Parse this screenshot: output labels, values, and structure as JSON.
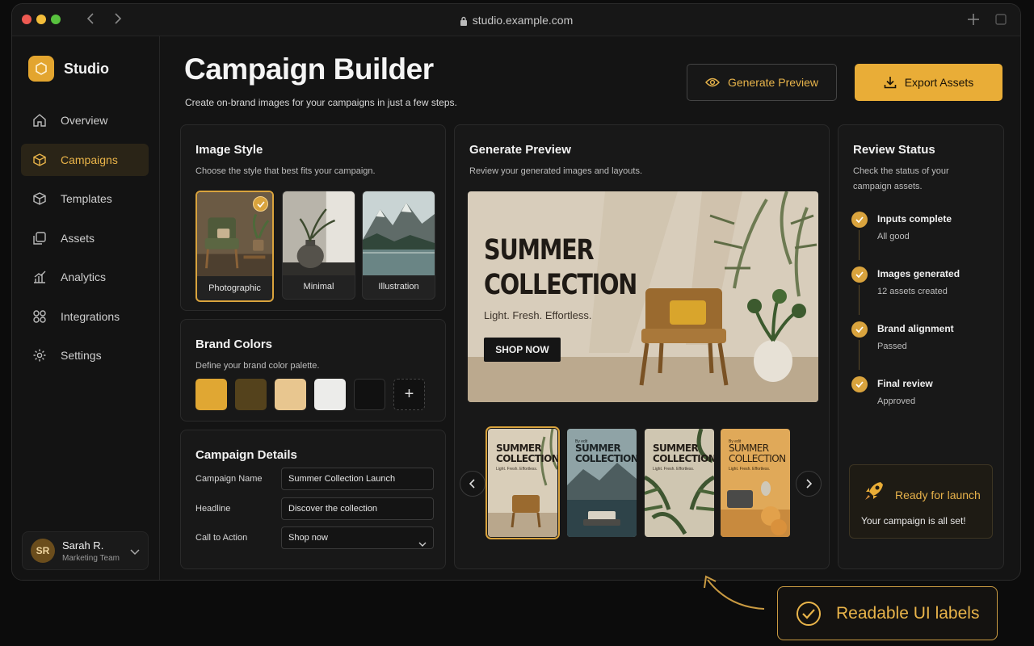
{
  "browser": {
    "url": "studio.example.com"
  },
  "brand": {
    "name": "Studio"
  },
  "nav": {
    "items": [
      {
        "label": "Overview",
        "icon": "home-icon"
      },
      {
        "label": "Campaigns",
        "icon": "box-icon",
        "active": true
      },
      {
        "label": "Templates",
        "icon": "cube-icon"
      },
      {
        "label": "Assets",
        "icon": "layers-icon"
      },
      {
        "label": "Analytics",
        "icon": "chart-icon"
      },
      {
        "label": "Integrations",
        "icon": "integrations-icon"
      },
      {
        "label": "Settings",
        "icon": "gear-icon"
      }
    ]
  },
  "user": {
    "initials": "SR",
    "name": "Sarah R.",
    "role": "Marketing Team"
  },
  "header": {
    "title": "Campaign Builder",
    "subtitle": "Create on-brand images for your campaigns in just a few steps.",
    "generate_label": "Generate Preview",
    "export_label": "Export Assets"
  },
  "image_style": {
    "title": "Image Style",
    "subtitle": "Choose the style that best fits your campaign.",
    "options": [
      {
        "label": "Photographic",
        "selected": true
      },
      {
        "label": "Minimal",
        "selected": false
      },
      {
        "label": "Illustration",
        "selected": false
      }
    ]
  },
  "brand_colors": {
    "title": "Brand Colors",
    "subtitle": "Define your brand color palette.",
    "colors": [
      "#e0a733",
      "#54421c",
      "#e8c68f",
      "#ececea",
      "#111111"
    ],
    "add_label": "+"
  },
  "details": {
    "title": "Campaign Details",
    "fields": [
      {
        "label": "Campaign Name",
        "value": "Summer Collection Launch"
      },
      {
        "label": "Headline",
        "value": "Discover the collection"
      },
      {
        "label": "Call to Action",
        "value": "Shop now"
      }
    ]
  },
  "preview": {
    "title": "Generate Preview",
    "subtitle": "Review your generated images and layouts.",
    "hero_title": "SUMMER\nCOLLECTION",
    "hero_tagline": "Light. Fresh. Effortless.",
    "hero_cta": "SHOP NOW",
    "thumbnails": [
      {
        "kicker": "",
        "title": "SUMMER\nCOLLECTION",
        "sub": "Light. Fresh. Effortless."
      },
      {
        "kicker": "By edit",
        "title": "SUMMER\nCOLLECTION",
        "sub": ""
      },
      {
        "kicker": "",
        "title": "SUMMER\nCOLLECTION",
        "sub": "Light. Fresh. Effortless."
      },
      {
        "kicker": "By edit",
        "title": "SUMMER\nCOLLECTION",
        "sub": "Light. Fresh. Effortless."
      }
    ]
  },
  "review": {
    "title": "Review Status",
    "subtitle": "Check the status of your campaign assets.",
    "steps": [
      {
        "title": "Inputs complete",
        "sub": "All good"
      },
      {
        "title": "Images generated",
        "sub": "12 assets created"
      },
      {
        "title": "Brand alignment",
        "sub": "Passed"
      },
      {
        "title": "Final review",
        "sub": "Approved"
      }
    ],
    "launch_title": "Ready for launch",
    "launch_sub": "Your campaign is all set!"
  },
  "callout": {
    "label": "Readable UI labels"
  },
  "colors": {
    "accent": "#e9ad37",
    "background": "#141414"
  }
}
